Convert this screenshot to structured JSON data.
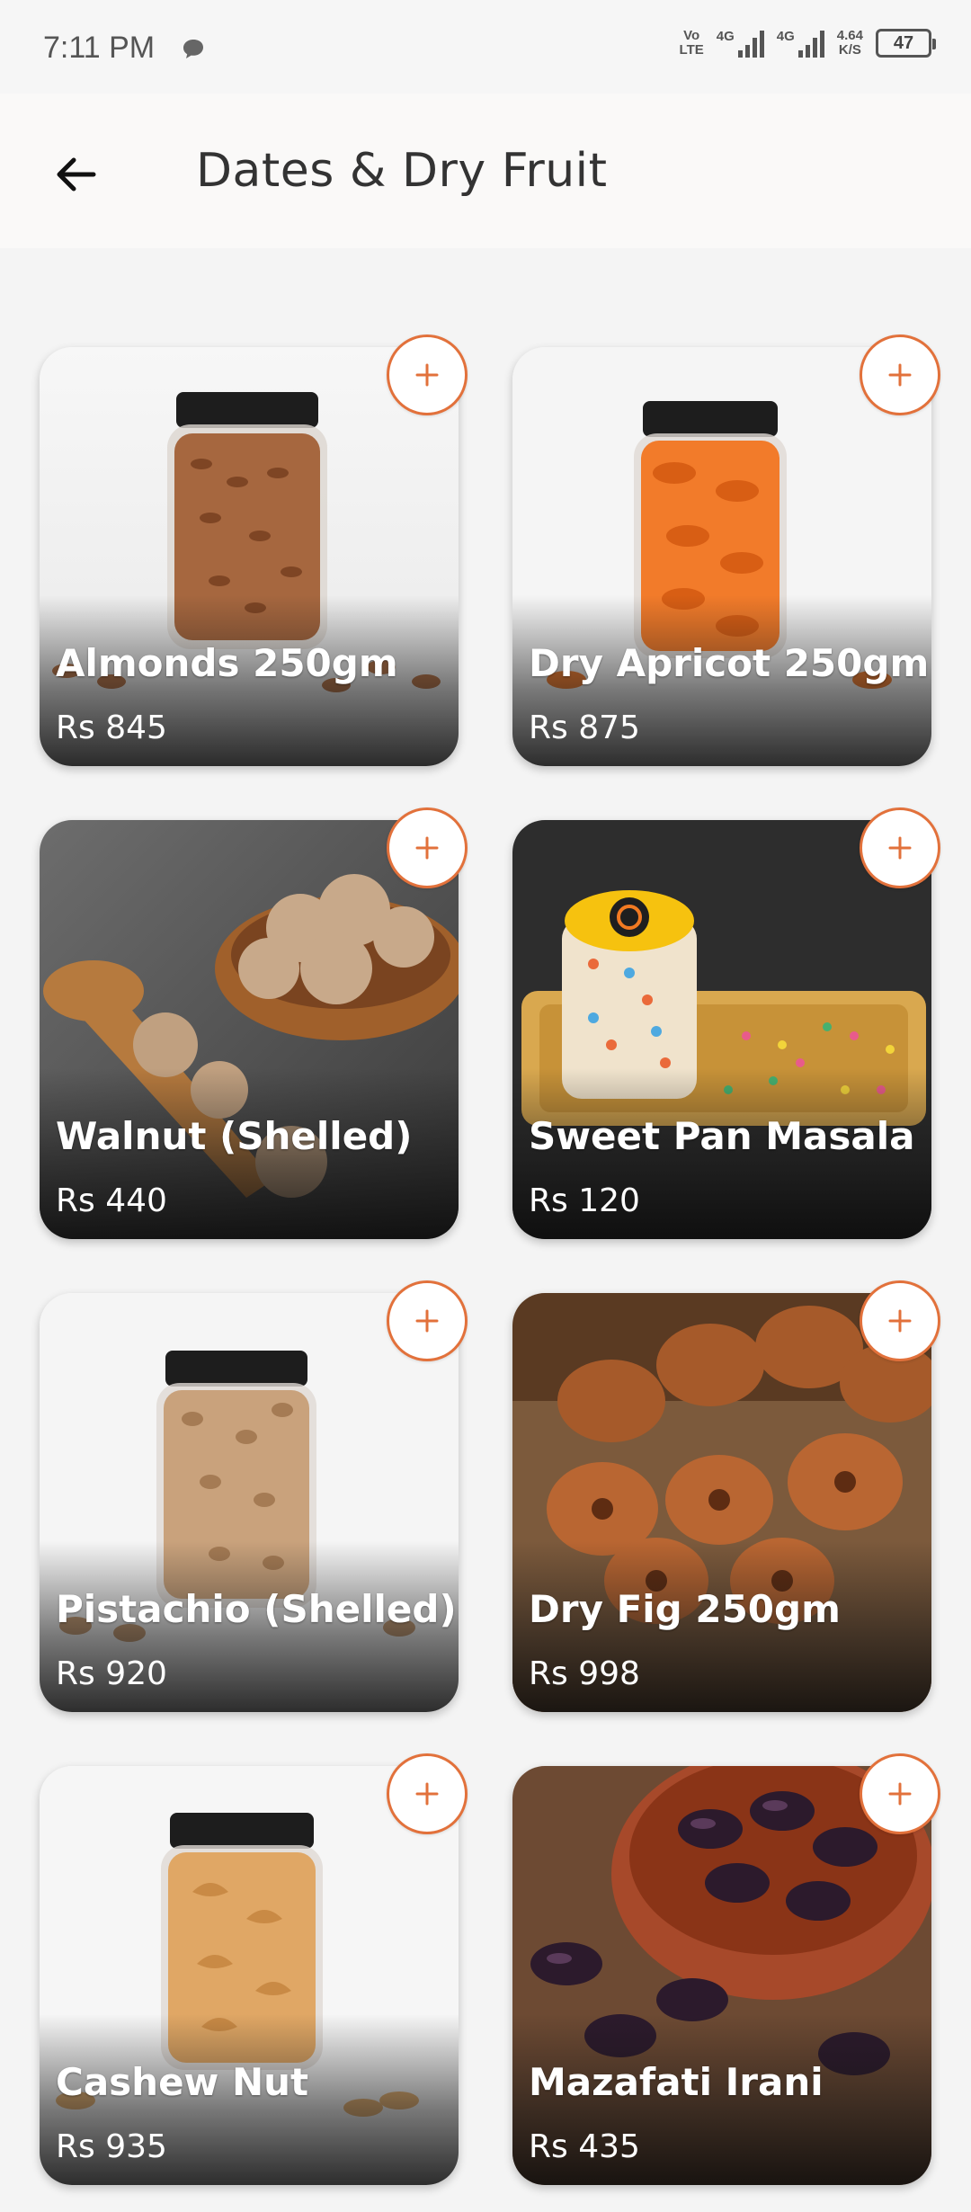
{
  "status_bar": {
    "time": "7:11 PM",
    "volte_top": "Vo",
    "volte_bottom": "LTE",
    "sim1": "4G",
    "sim2": "4G",
    "speed_value": "4.64",
    "speed_unit": "K/S",
    "battery": "47"
  },
  "header": {
    "title": "Dates & Dry Fruit"
  },
  "colors": {
    "accent": "#e2713b",
    "background": "#f4f4f4",
    "appbar": "#faf9f8"
  },
  "products": [
    {
      "name": "Almonds 250gm",
      "price": "Rs 845"
    },
    {
      "name": "Dry Apricot 250gm",
      "price": "Rs 875"
    },
    {
      "name": "Walnut (Shelled)",
      "price": "Rs 440"
    },
    {
      "name": "Sweet Pan Masala",
      "price": "Rs 120"
    },
    {
      "name": "Pistachio (Shelled)",
      "price": "Rs 920"
    },
    {
      "name": "Dry Fig 250gm",
      "price": "Rs 998"
    },
    {
      "name": "Cashew Nut",
      "price": "Rs 935"
    },
    {
      "name": "Mazafati Irani",
      "price": "Rs 435"
    }
  ],
  "icons": {
    "back": "arrow-left-icon",
    "add": "plus-icon"
  }
}
